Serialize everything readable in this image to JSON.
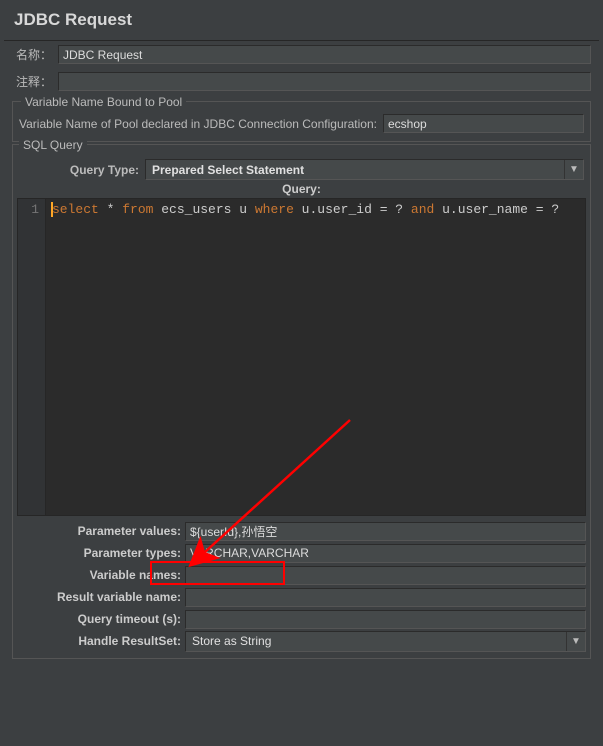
{
  "title": "JDBC Request",
  "name_label": "名称：",
  "name_value": "JDBC Request",
  "comment_label": "注释：",
  "comment_value": "",
  "pool_group": {
    "legend": "Variable Name Bound to Pool",
    "label": "Variable Name of Pool declared in JDBC Connection Configuration:",
    "value": "ecshop"
  },
  "sql_group": {
    "legend": "SQL Query",
    "qtype_label": "Query Type:",
    "qtype_value": "Prepared Select Statement",
    "query_label": "Query:",
    "line_no": "1",
    "tokens": {
      "select": "select",
      "star": " * ",
      "from": "from",
      "tbl": " ecs_users u ",
      "where": "where",
      "c1": " u.user_id = ? ",
      "and": "and",
      "c2": " u.user_name = ?"
    }
  },
  "params": {
    "values_label": "Parameter values:",
    "values_value": "${userId},孙悟空",
    "types_label": "Parameter types:",
    "types_value": "VARCHAR,VARCHAR",
    "varnames_label": "Variable names:",
    "varnames_value": "",
    "resultvar_label": "Result variable name:",
    "resultvar_value": "",
    "timeout_label": "Query timeout (s):",
    "timeout_value": "",
    "handle_label": "Handle ResultSet:",
    "handle_value": "Store as String"
  },
  "dropdown_glyph": "▼"
}
